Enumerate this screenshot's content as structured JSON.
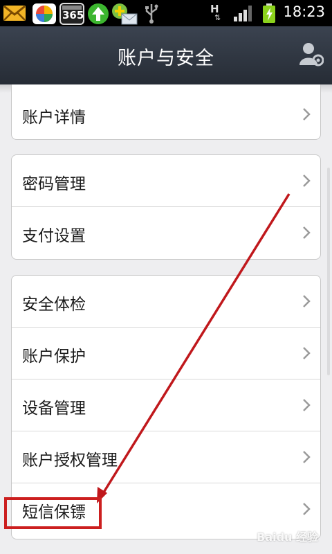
{
  "status_bar": {
    "time": "18:23",
    "calendar_badge": "365",
    "network_type": "H",
    "icons": [
      "mail-icon",
      "app-store-icon",
      "calendar-365-icon",
      "upload-arrow-icon",
      "message-icon",
      "usb-icon",
      "network-h-icon",
      "signal-icon",
      "battery-charging-icon"
    ]
  },
  "header": {
    "title": "账户与安全",
    "right_icon": "account-settings-icon"
  },
  "groups": [
    {
      "items": [
        {
          "label": "账户详情"
        }
      ]
    },
    {
      "items": [
        {
          "label": "密码管理"
        },
        {
          "label": "支付设置"
        }
      ]
    },
    {
      "items": [
        {
          "label": "安全体检"
        },
        {
          "label": "账户保护"
        },
        {
          "label": "设备管理"
        },
        {
          "label": "账户授权管理"
        },
        {
          "label": "短信保镖"
        }
      ]
    }
  ],
  "annotation": {
    "color": "#cc1f1f",
    "highlighted_item": "短信保镖"
  },
  "watermark": "Baidu 经验"
}
